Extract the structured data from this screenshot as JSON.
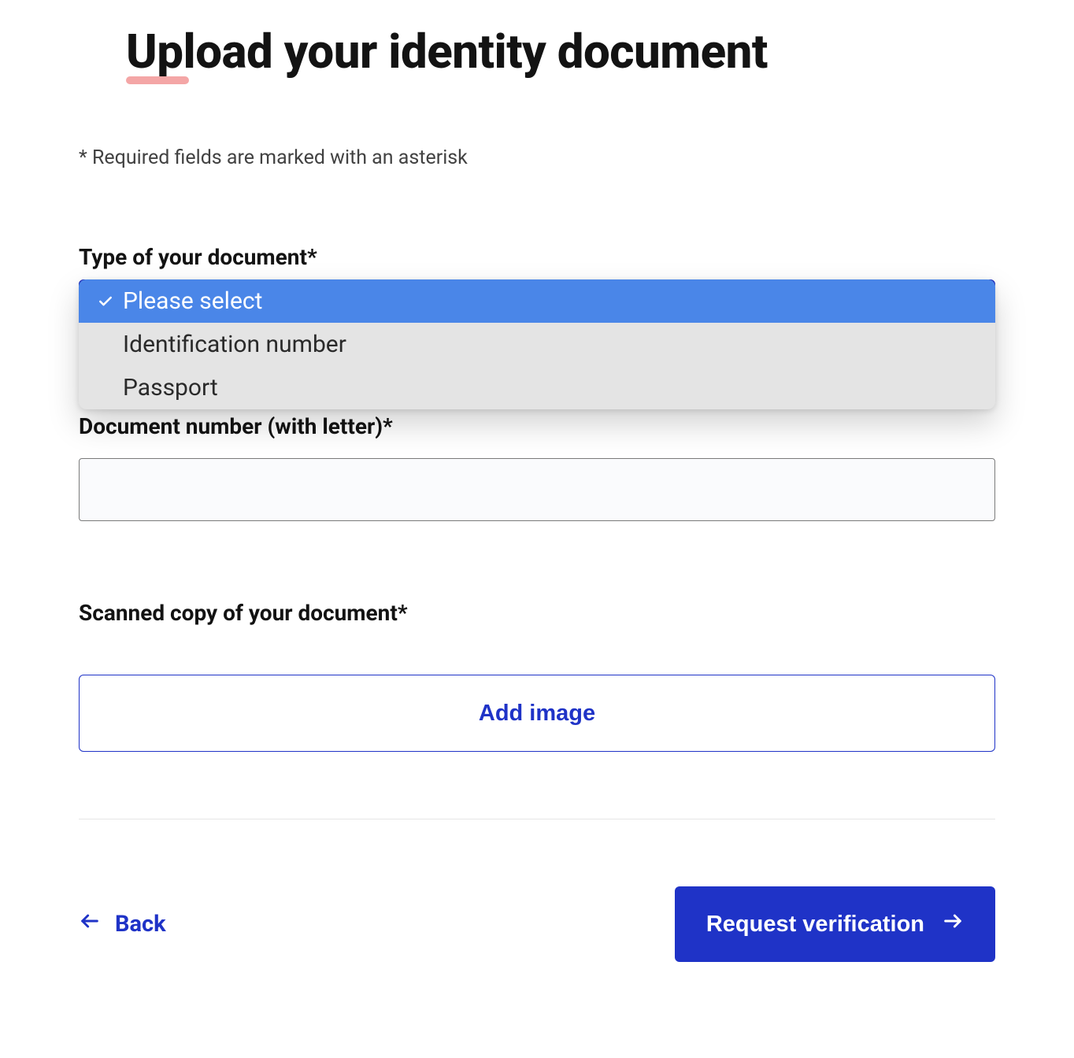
{
  "title": "Upload your identity document",
  "required_note": "* Required fields are marked with an asterisk",
  "fields": {
    "doc_type": {
      "label": "Type of your document*",
      "options": [
        "Please select",
        "Identification number",
        "Passport"
      ],
      "selected_index": 0
    },
    "doc_number": {
      "label": "Document number (with letter)*",
      "value": ""
    },
    "scanned_copy": {
      "label": "Scanned copy of your document*",
      "button_label": "Add image"
    }
  },
  "footer": {
    "back_label": "Back",
    "submit_label": "Request verification"
  }
}
